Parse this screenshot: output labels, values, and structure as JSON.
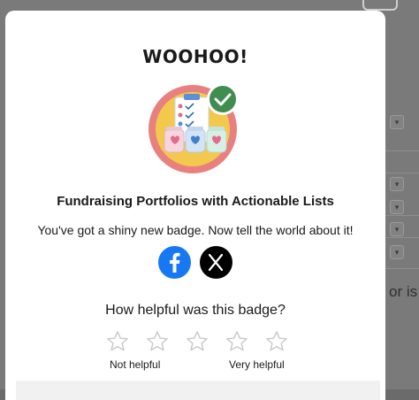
{
  "modal": {
    "title": "WOOHOO!",
    "badge_name": "Fundraising Portfolios with Actionable Lists",
    "message": "You've got a shiny new badge. Now tell the world about it!",
    "share": [
      {
        "network": "Facebook",
        "icon": "facebook-icon"
      },
      {
        "network": "X",
        "icon": "x-icon"
      }
    ],
    "rating": {
      "question": "How helpful was this badge?",
      "stars": 5,
      "selected": 0,
      "low_label": "Not helpful",
      "high_label": "Very helpful"
    }
  },
  "background": {
    "right_fragment": "or is"
  },
  "colors": {
    "facebook": "#1877f2",
    "x": "#000000",
    "badge_ring": "#e98080",
    "badge_fill": "#f2c94c",
    "check_badge": "#3e8e4f"
  }
}
